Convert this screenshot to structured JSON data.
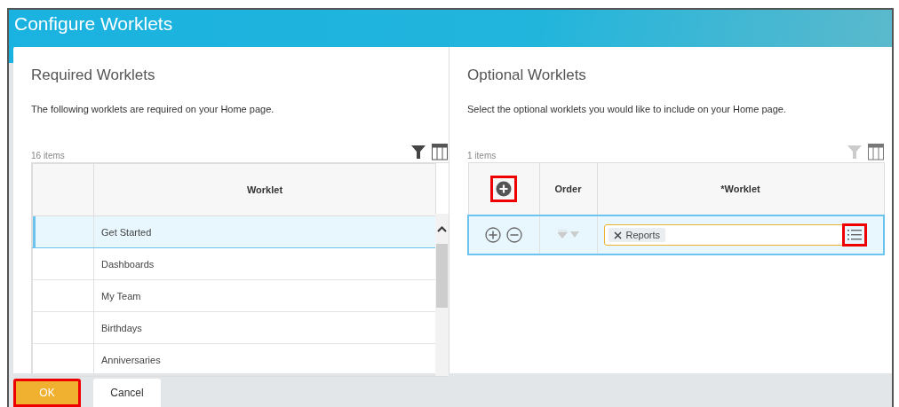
{
  "window": {
    "title": "Configure Worklets"
  },
  "required": {
    "heading": "Required Worklets",
    "description": "The following worklets are required on your Home page.",
    "count": "16 items",
    "columns": [
      "Worklet"
    ],
    "rows": [
      {
        "worklet": "Get Started",
        "selected": true
      },
      {
        "worklet": "Dashboards",
        "selected": false
      },
      {
        "worklet": "My Team",
        "selected": false
      },
      {
        "worklet": "Birthdays",
        "selected": false
      },
      {
        "worklet": "Anniversaries",
        "selected": false
      }
    ]
  },
  "optional": {
    "heading": "Optional Worklets",
    "description": "Select the optional worklets you would like to include on your Home page.",
    "count": "1 items",
    "columns": [
      "Order",
      "*Worklet"
    ],
    "add_highlighted": true,
    "rows": [
      {
        "selected": true,
        "worklet": "Reports",
        "prompt_highlighted": true
      }
    ]
  },
  "buttons": [
    {
      "label": "OK",
      "kind": "primary",
      "highlighted": true
    },
    {
      "label": "Cancel",
      "kind": "secondary",
      "highlighted": false
    }
  ]
}
